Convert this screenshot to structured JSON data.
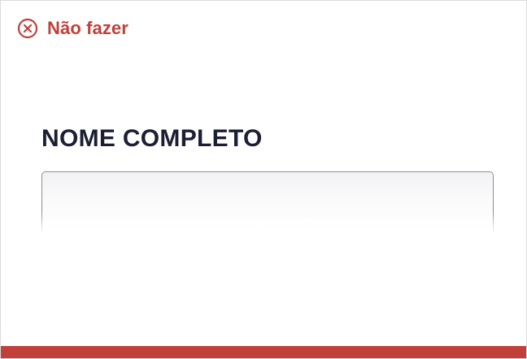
{
  "header": {
    "icon": "close-circle-icon",
    "title": "Não fazer"
  },
  "field": {
    "label": "NOME COMPLETO",
    "value": "",
    "placeholder": ""
  },
  "colors": {
    "accent": "#c1403a",
    "label_text": "#1c1e33",
    "input_border": "#8c8c96"
  }
}
